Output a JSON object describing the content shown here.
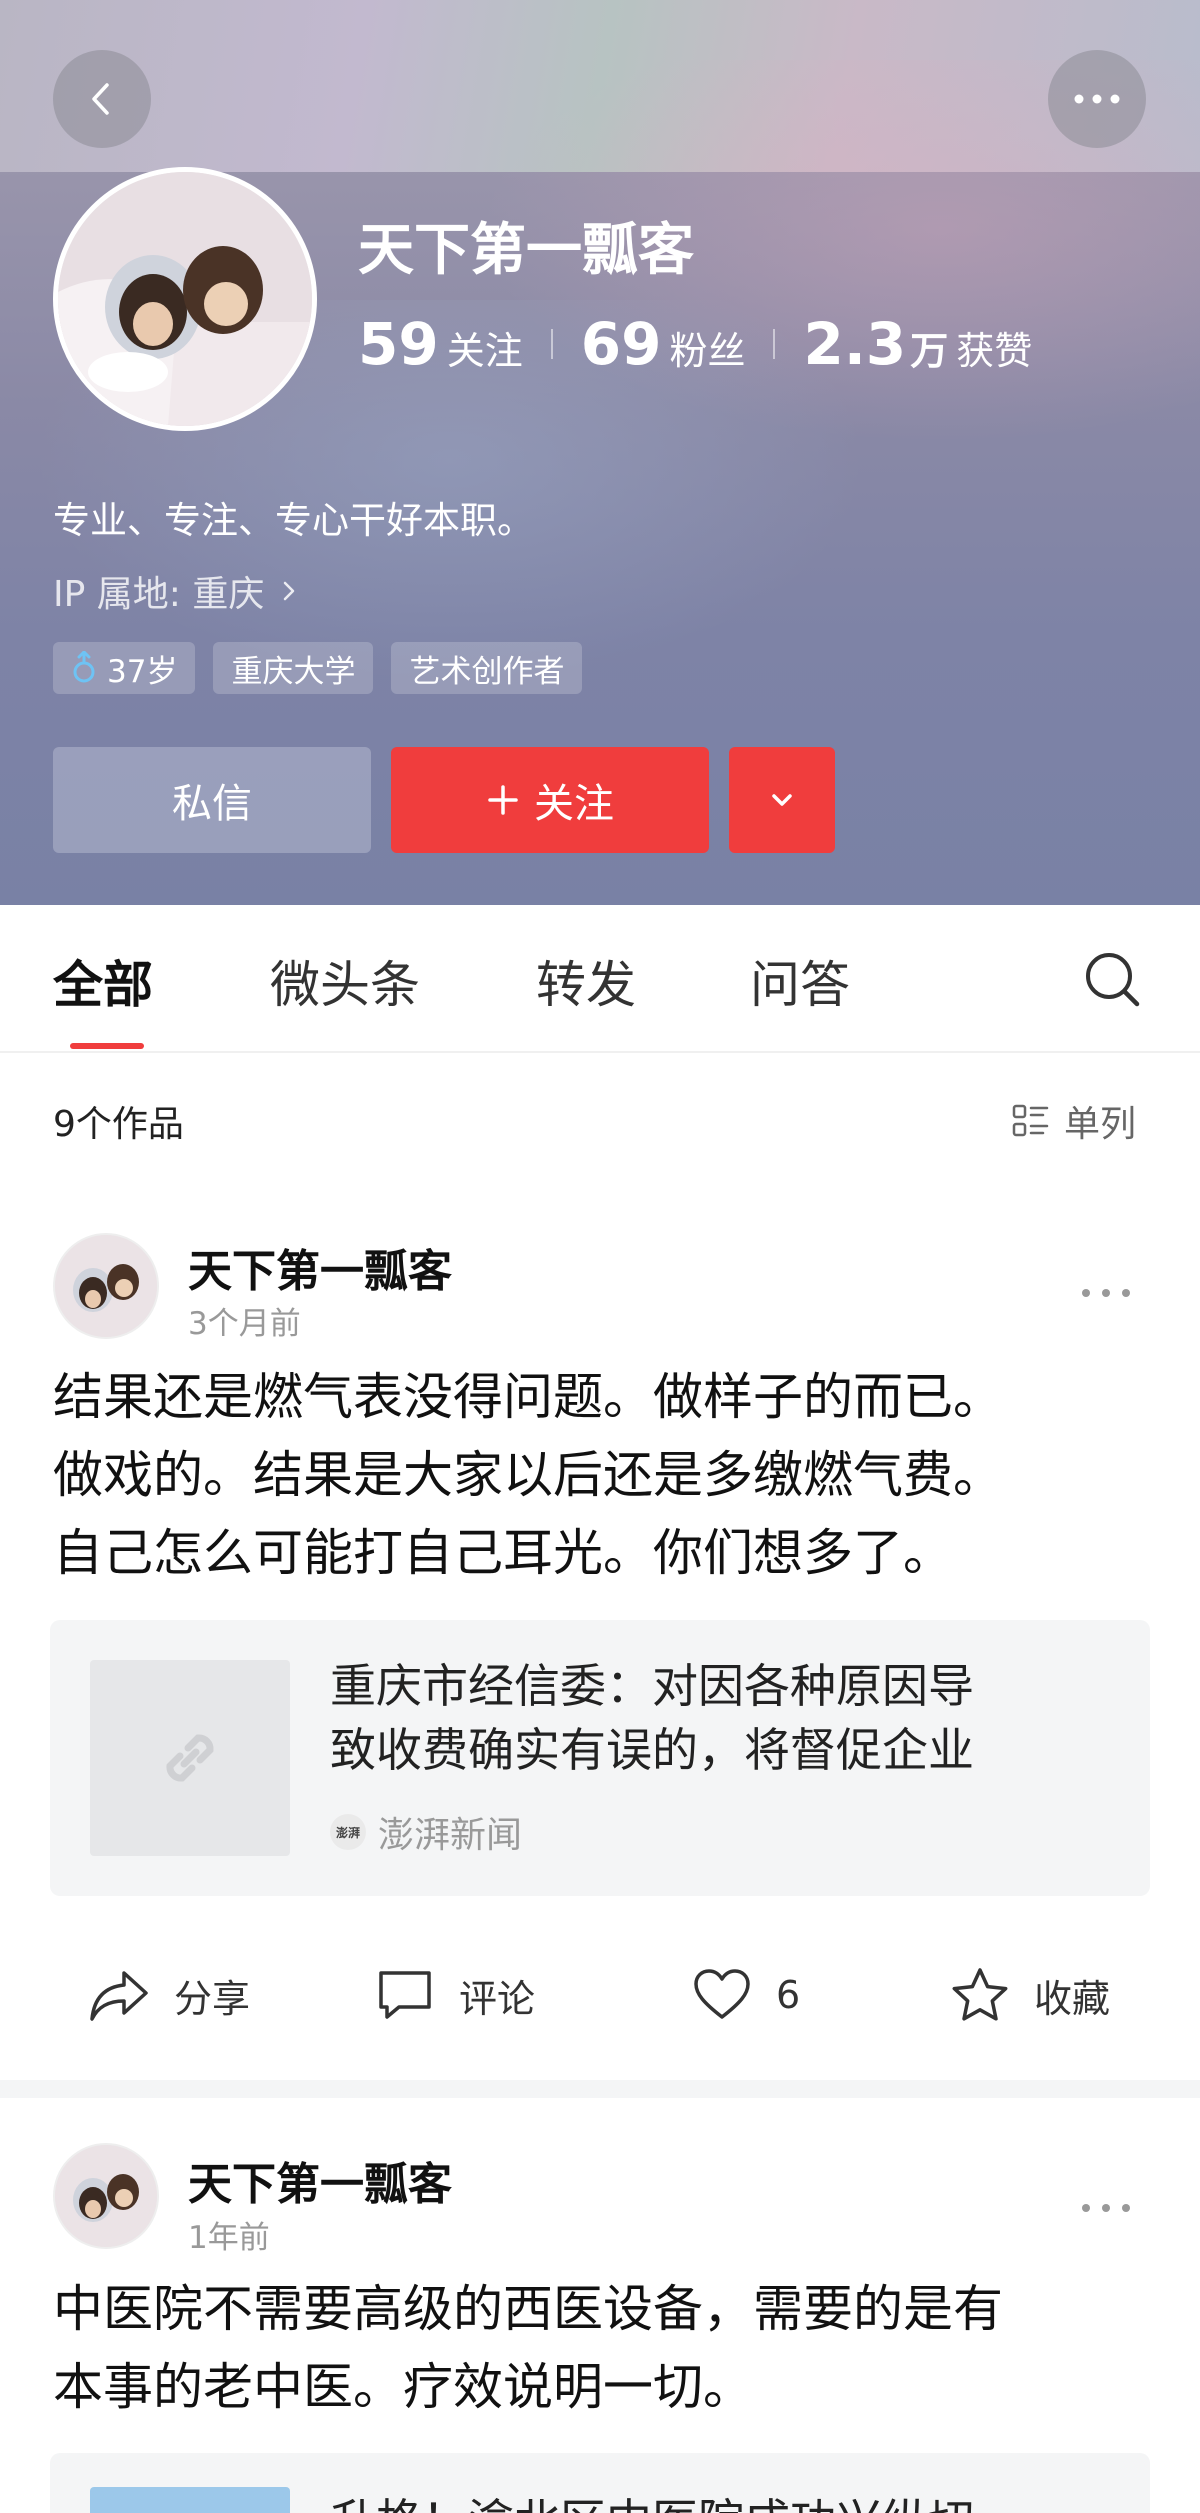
{
  "profile": {
    "name": "天下第一瓢客",
    "stats": {
      "following": "59",
      "following_label": "关注",
      "followers": "69",
      "followers_label": "粉丝",
      "likes": "2.3",
      "likes_unit": "万",
      "likes_label": "获赞"
    },
    "bio": "专业、专注、专心干好本职。",
    "ip": "IP 属地: 重庆",
    "tags": [
      "37岁",
      "重庆大学",
      "艺术创作者"
    ],
    "message_label": "私信",
    "follow_label": "关注"
  },
  "tabs": [
    "全部",
    "微头条",
    "转发",
    "问答"
  ],
  "works_count": "9个作品",
  "view_label": "单列",
  "posts": [
    {
      "author": "天下第一瓢客",
      "time": "3个月前",
      "lines": [
        "结果还是燃气表没得问题。做样子的而已。",
        "做戏的。结果是大家以后还是多缴燃气费。",
        "自己怎么可能打自己耳光。你们想多了。"
      ],
      "link_title": [
        "重庆市经信委：对因各种原因导",
        "致收费确实有误的，将督促企业"
      ],
      "link_source": "澎湃新闻",
      "source_badge": "澎湃",
      "actions": {
        "share": "分享",
        "comment": "评论",
        "likes": "6",
        "favorite": "收藏"
      }
    },
    {
      "author": "天下第一瓢客",
      "time": "1年前",
      "lines": [
        "中医院不需要高级的西医设备，需要的是有",
        "本事的老中医。疗效说明一切。"
      ],
      "link_title_partial": "升格！渝北区中医院成功兴纵切"
    }
  ],
  "colors": {
    "accent": "#f03d3d",
    "header_bg": "#8a89a6"
  },
  "icons": [
    "back-icon",
    "more-icon",
    "chevron-right-icon",
    "gender-icon",
    "plus-icon",
    "chevron-down-icon",
    "search-icon",
    "list-view-icon",
    "link-icon",
    "share-icon",
    "comment-icon",
    "like-icon",
    "star-icon"
  ]
}
